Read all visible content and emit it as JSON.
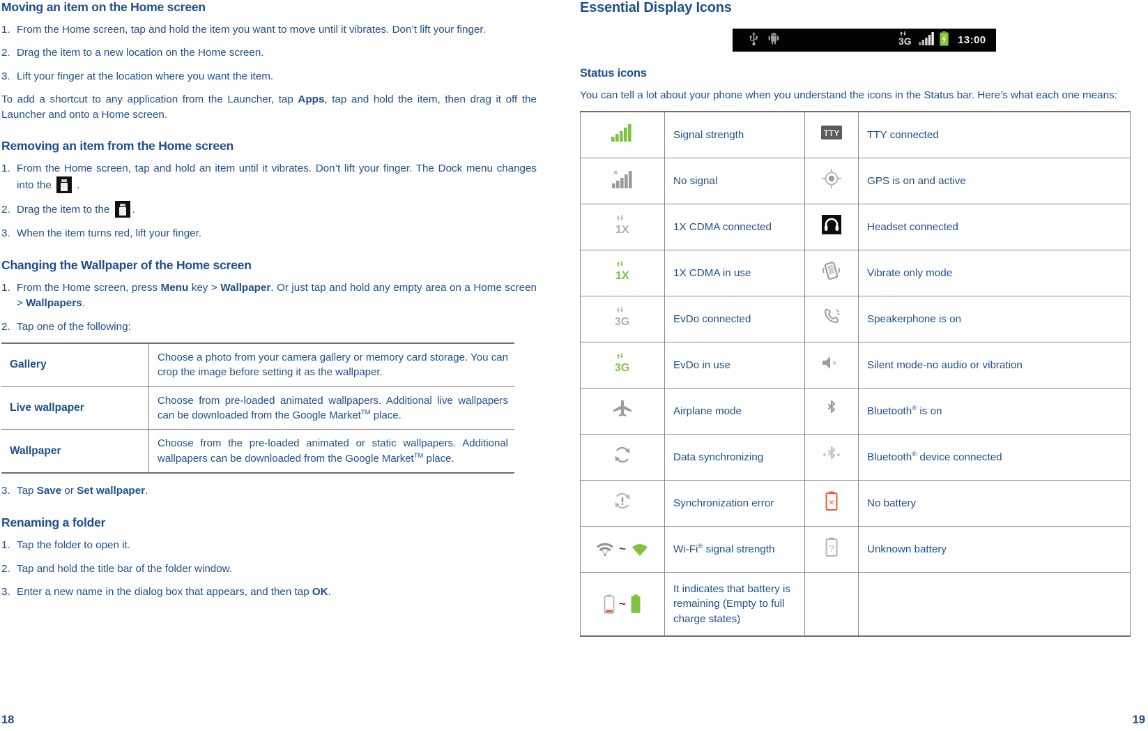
{
  "colors": {
    "text_blue": "#1F4E8C",
    "rule_gray": "#6e6e6e",
    "signal_green": "#7DC243",
    "battery_red": "#F05A28",
    "statusbar_bg": "#030303"
  },
  "left_page": {
    "page_number": "18",
    "sections": [
      {
        "heading": "Moving an item on the Home screen",
        "items": [
          {
            "num": "1.",
            "text": "From the Home screen, tap and hold the item you want to move until it vibrates. Don’t lift your finger."
          },
          {
            "num": "2.",
            "text": "Drag the item to a new location on the Home screen."
          },
          {
            "num": "3.",
            "text": "Lift your finger at the location where you want the item."
          }
        ],
        "paragraph_pre": "To add a shortcut to any application from the Launcher, tap ",
        "paragraph_bold": "Apps",
        "paragraph_post": ", tap and hold the item, then drag it off the Launcher and onto a Home screen."
      },
      {
        "heading": "Removing an item from the Home screen",
        "item1_pre": "From the Home screen, tap and hold an item until it vibrates. Don’t lift your finger. The Dock menu changes into the ",
        "item1_post": " .",
        "item2_pre": "Drag the item to the ",
        "item2_post": ".",
        "item3": "When the item turns red, lift your finger.",
        "nums": [
          "1.",
          "2.",
          "3."
        ]
      },
      {
        "heading": "Changing the Wallpaper of the Home screen",
        "item1_a": "From the Home screen, press ",
        "item1_b": "Menu",
        "item1_c": " key > ",
        "item1_d": "Wallpaper",
        "item1_e": ". Or just tap and hold any empty area on a Home screen > ",
        "item1_f": "Wallpapers",
        "item1_g": ".",
        "item2": "Tap one of the following:",
        "nums": [
          "1.",
          "2."
        ]
      }
    ],
    "wallpaper_table": {
      "rows": [
        {
          "label": "Gallery",
          "description": "Choose a photo from your camera gallery or memory card storage. You can crop the image before setting it as the wallpaper.",
          "has_tm": false
        },
        {
          "label": "Live wallpaper",
          "desc_pre": "Choose from pre-loaded animated wallpapers. Additional live wallpapers can be downloaded from the Google Market",
          "desc_tm": "TM",
          "desc_post": " place.",
          "has_tm": true
        },
        {
          "label": "Wallpaper",
          "desc_pre": "Choose from the pre-loaded animated or static wallpapers. Additional wallpapers can be downloaded from the Google Market",
          "desc_tm": "TM",
          "desc_post": " place.",
          "has_tm": true
        }
      ]
    },
    "after_table": {
      "step3_a": "Tap ",
      "step3_b": "Save",
      "step3_c": " or ",
      "step3_d": "Set wallpaper",
      "step3_e": ".",
      "step3_num": "3."
    },
    "renaming": {
      "heading": "Renaming a folder",
      "items": [
        {
          "num": "1.",
          "text": "Tap the folder to open it."
        },
        {
          "num": "2.",
          "text": "Tap and hold the title bar of the folder window."
        }
      ],
      "item3_num": "3.",
      "item3_pre": "Enter a new name in the dialog box that appears, and then tap ",
      "item3_bold": "OK",
      "item3_post": "."
    }
  },
  "right_page": {
    "page_number": "19",
    "title": "Essential Display Icons",
    "statusbar": {
      "left_icons": [
        "usb-icon",
        "android-robot-icon"
      ],
      "right_icons": [
        "3g-data-icon",
        "signal-bars-icon",
        "battery-charging-icon"
      ],
      "clock": "13:00"
    },
    "status_icons_heading": "Status icons",
    "intro": "You can tell a lot about your phone when you understand the icons in the Status bar. Here’s what each one means:",
    "icons_table": {
      "rows": [
        {
          "icon_left": "signal-bars-green-icon",
          "label_left": "Signal strength",
          "icon_right": "tty-icon",
          "label_right": "TTY connected"
        },
        {
          "icon_left": "no-signal-icon",
          "label_left": "No signal",
          "icon_right": "gps-icon",
          "label_right": "GPS is on and active"
        },
        {
          "icon_left": "1x-cdma-gray-icon",
          "label_left": "1X CDMA connected",
          "icon_right": "headset-icon",
          "label_right": "Headset connected"
        },
        {
          "icon_left": "1x-cdma-green-icon",
          "label_left": "1X CDMA in use",
          "icon_right": "vibrate-icon",
          "label_right": "Vibrate only mode"
        },
        {
          "icon_left": "evdo-3g-gray-icon",
          "label_left": "EvDo connected",
          "icon_right": "speakerphone-icon",
          "label_right": "Speakerphone is on"
        },
        {
          "icon_left": "evdo-3g-green-icon",
          "label_left": "EvDo in use",
          "icon_right": "silent-mode-icon",
          "label_right": "Silent mode-no audio or vibration"
        },
        {
          "icon_left": "airplane-icon",
          "label_left": "Airplane mode",
          "icon_right": "bluetooth-icon",
          "label_right_pre": "Bluetooth",
          "label_right_sup": "®",
          "label_right_post": " is on"
        },
        {
          "icon_left": "sync-icon",
          "label_left": "Data synchronizing",
          "icon_right": "bluetooth-connected-icon",
          "label_right_pre": "Bluetooth",
          "label_right_sup": "®",
          "label_right_post": " device connected"
        },
        {
          "icon_left": "sync-error-icon",
          "label_left": "Synchronization error",
          "icon_right": "no-battery-icon",
          "label_right": "No battery"
        },
        {
          "icon_left": "wifi-range-icon",
          "label_left_pre": "Wi-Fi",
          "label_left_sup": "®",
          "label_left_post": " signal strength",
          "icon_right": "unknown-battery-icon",
          "label_right": "Unknown battery"
        },
        {
          "icon_left": "battery-range-icon",
          "label_left": "It indicates that battery is remaining (Empty to full charge states)",
          "icon_right": "",
          "label_right": ""
        }
      ]
    }
  }
}
